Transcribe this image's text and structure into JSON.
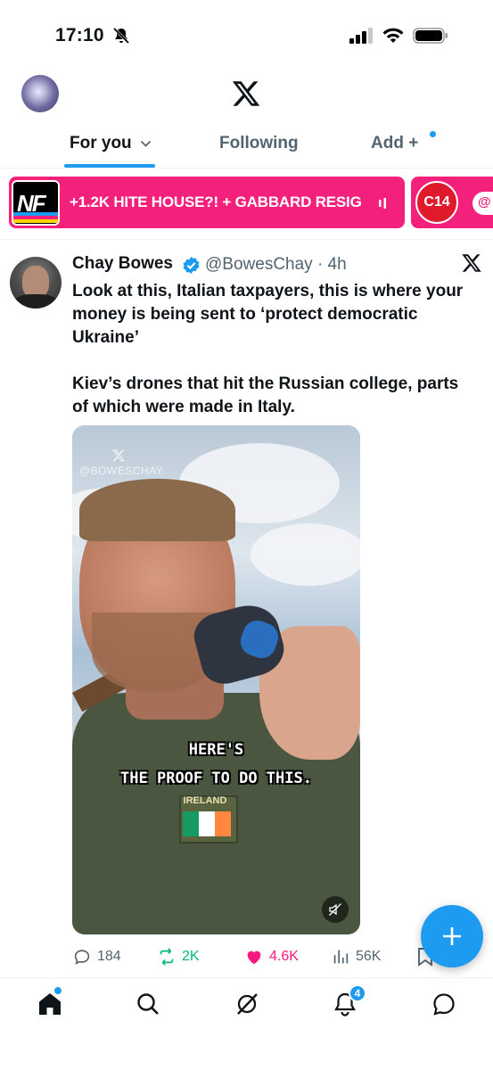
{
  "status_bar": {
    "time": "17:10"
  },
  "header": {
    "tabs": [
      {
        "label": "For you",
        "active": true
      },
      {
        "label": "Following",
        "active": false
      },
      {
        "label": "Add +",
        "active": false
      }
    ]
  },
  "spaces_bar": {
    "logo_text": "NF",
    "text": "+1.2K HITE HOUSE?! + GABBARD RESIG",
    "next_logo_text": "C14",
    "next_partial": "@"
  },
  "tweet": {
    "author_name": "Chay Bowes",
    "handle_time": "@BowesChay · 4h",
    "text_p1": "Look at this, Italian taxpayers, this is where your money is being sent to ‘protect democratic Ukraine’",
    "text_p2": "Kiev’s drones that hit the Russian college, parts of which were made in Italy.",
    "media": {
      "watermark": "@BOWESCHAY",
      "caption_line1": "HERE'S",
      "caption_line2": "THE PROOF TO DO THIS.",
      "patch_label": "IRELAND"
    },
    "stats": {
      "replies": "184",
      "reposts": "2K",
      "likes": "4.6K",
      "views": "56K"
    }
  },
  "bottom_nav": {
    "notifications_badge": "4"
  },
  "colors": {
    "accent": "#1d9bf0",
    "spaces_pink": "#f3217c",
    "repost_green": "#00ba7c",
    "like_pink": "#f91880"
  }
}
